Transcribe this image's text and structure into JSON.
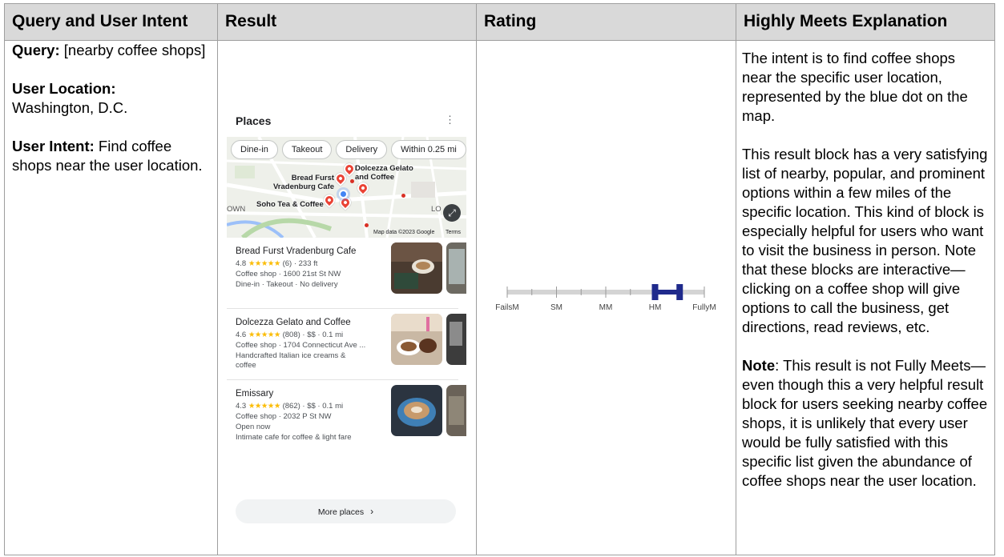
{
  "header": {
    "col1": "Query and User Intent",
    "col2": "Result",
    "col3": "Rating",
    "col4": "Highly Meets Explanation"
  },
  "intent": {
    "query_label": "Query:",
    "query_value": " [nearby coffee shops]",
    "location_label": "User Location:",
    "location_value": "Washington, D.C.",
    "intent_label": "User Intent:",
    "intent_value": "  Find coffee shops near the user location."
  },
  "result": {
    "card_title": "Places",
    "menu_glyph": "⋮",
    "chips": [
      "Dine-in",
      "Takeout",
      "Delivery",
      "Within 0.25 mi"
    ],
    "map_labels": {
      "dolcezza": "Dolcezza Gelato\nand Coffee",
      "bread_furst": "Bread Furst\nVradenburg Cafe",
      "soho": "Soho Tea & Coffee",
      "own": "OWN",
      "lo": "LO",
      "credit": "Map data ©2023 Google",
      "terms": "Terms"
    },
    "places": [
      {
        "name": "Bread Furst Vradenburg Cafe",
        "rating": "4.8",
        "stars": "★★★★★",
        "meta": "(6) · 233 ft",
        "line2": "Coffee shop · 1600 21st St NW",
        "line3": "Dine-in · Takeout · No delivery",
        "line4": ""
      },
      {
        "name": "Dolcezza Gelato and Coffee",
        "rating": "4.6",
        "stars": "★★★★★",
        "meta": "(808) · $$ · 0.1 mi",
        "line2": "Coffee shop · 1704 Connecticut Ave ...",
        "line3": "Handcrafted Italian ice creams &",
        "line4": "coffee"
      },
      {
        "name": "Emissary",
        "rating": "4.3",
        "stars": "★★★★★",
        "meta": "(862) · $$ · 0.1 mi",
        "line2": "Coffee shop · 2032 P St NW",
        "line3": "Open now",
        "line4": "Intimate cafe for coffee & light fare"
      }
    ],
    "more_label": "More places",
    "more_chevron": "›"
  },
  "rating": {
    "labels": [
      "FailsM",
      "SM",
      "MM",
      "HM",
      "FullyM"
    ],
    "selected_from": 3,
    "selected_to": 3.5
  },
  "explanation": {
    "p1": "The intent is to find coffee shops near the specific user location, represented by the blue dot on the map.",
    "p2": "This result block has a very satisfying list of nearby, popular, and prominent options within a few miles of the specific location. This kind of block is especially helpful for users who want to visit the business in person.  Note that these blocks are interactive—clicking on a coffee shop will give options to call the business, get directions, read reviews, etc.",
    "p3_label": "Note",
    "p3": ": This result is not Fully Meets— even though this a very helpful result block for users seeking nearby coffee shops, it is unlikely that every user would be fully satisfied with this specific list given the abundance of coffee shops near the user location."
  },
  "colors": {
    "header_bg": "#d9d9d9",
    "rating_bar": "#1f2a8c",
    "pin": "#ea4335",
    "user_dot": "#4285f4",
    "stars": "#fbbc04"
  }
}
